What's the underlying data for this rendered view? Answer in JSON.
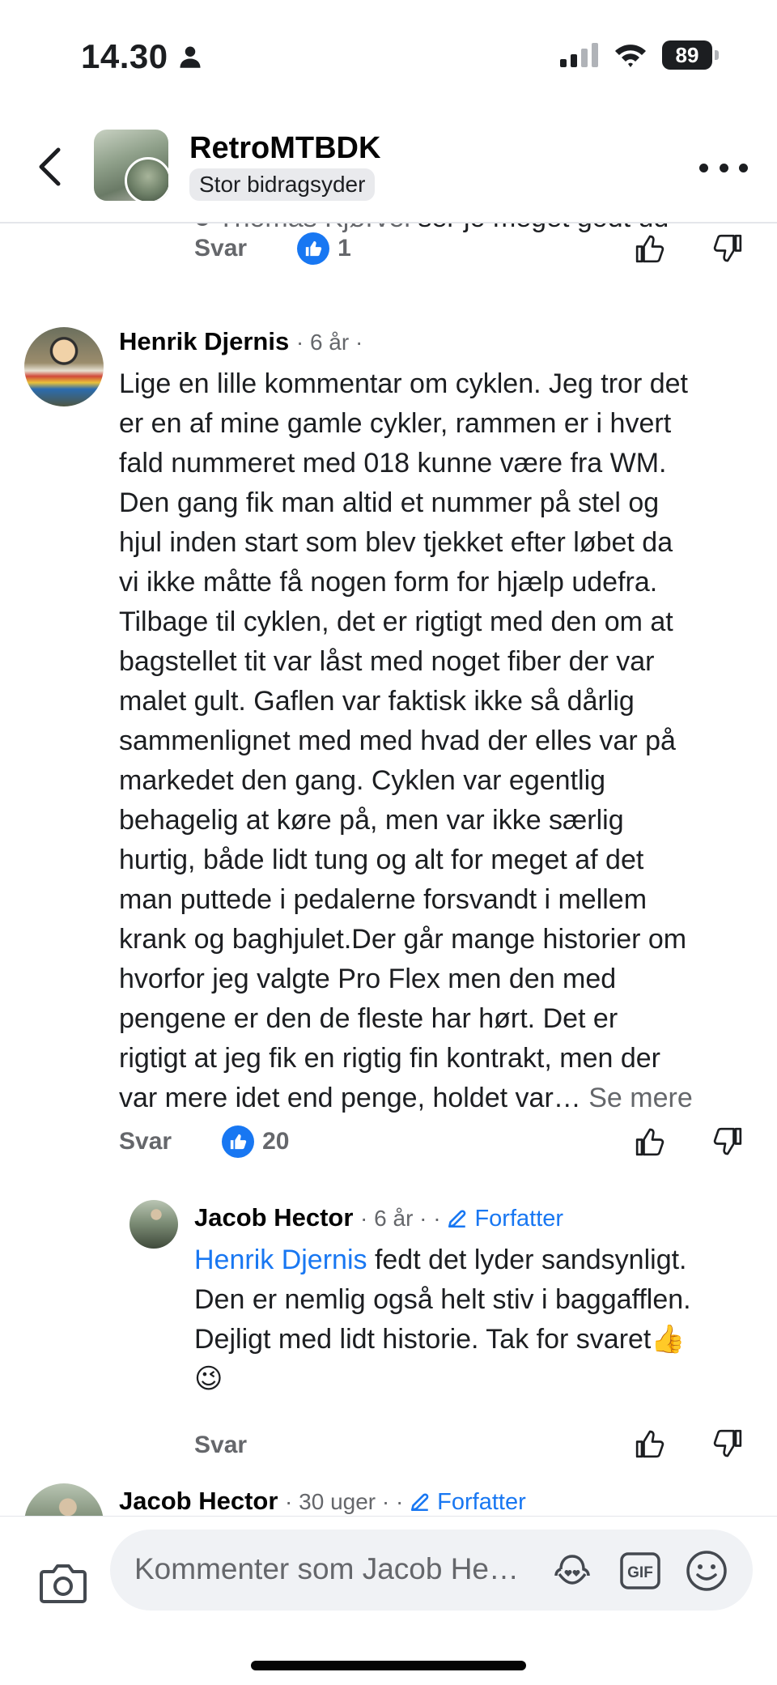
{
  "status_bar": {
    "time": "14.30",
    "battery": "89"
  },
  "header": {
    "group_name": "RetroMTBDK",
    "badge": "Stor bidragsyder"
  },
  "top_partial": {
    "author": "Thomas Kjørvel",
    "text": "ser jo meget godt ud",
    "reply_label": "Svar",
    "like_count": "1"
  },
  "comments": [
    {
      "author": "Henrik Djernis",
      "time": "6 år",
      "text": "Lige en lille kommentar om cyklen. Jeg tror det\ner en af mine gamle cykler, rammen er i hvert\nfald nummeret med 018 kunne være fra WM.\nDen gang fik man altid et nummer på stel og\nhjul inden start som blev tjekket efter løbet da\nvi ikke måtte få nogen form for hjælp udefra.\nTilbage til cyklen, det er rigtigt med den om at\nbagstellet tit var låst med noget fiber der var\nmalet gult. Gaflen var faktisk ikke så dårlig\nsammenlignet med med hvad der elles var på\nmarkedet den gang. Cyklen var egentlig\nbehagelig at køre på, men var ikke særlig\nhurtig, både lidt tung og alt for meget af det\nman puttede i pedalerne forsvandt i mellem\nkrank og baghjulet.Der går mange historier om\nhvorfor jeg valgte Pro Flex men den med\npengene er den de fleste har hørt. Det er\nrigtigt at jeg fik en rigtig fin kontrakt, men der\nvar mere  idet end penge, holdet var…",
      "see_more": "Se mere",
      "reply_label": "Svar",
      "like_count": "20"
    },
    {
      "author": "Jacob Hector",
      "time": "6 år",
      "badge": "Forfatter",
      "mention": "Henrik Djernis",
      "text": " fedt det lyder sandsynligt.\nDen er nemlig også helt stiv i baggafflen.\nDejligt med lidt historie. Tak for svaret👍\n😉",
      "reply_label": "Svar"
    },
    {
      "author": "Jacob Hector",
      "time": "30 uger",
      "badge": "Forfatter"
    }
  ],
  "composer": {
    "placeholder": "Kommenter som Jacob Hector"
  },
  "icons": {
    "back": "chevron-left-icon",
    "more": "more-horizontal-icon",
    "like": "thumbs-up-icon",
    "dislike": "thumbs-down-icon",
    "camera": "camera-icon",
    "avatar_sticker": "avatar-sticker-icon",
    "gif": "gif-icon",
    "emoji": "emoji-icon"
  },
  "colors": {
    "accent": "#1877f2",
    "secondary_text": "#65676b",
    "input_bg": "#f0f2f5"
  }
}
